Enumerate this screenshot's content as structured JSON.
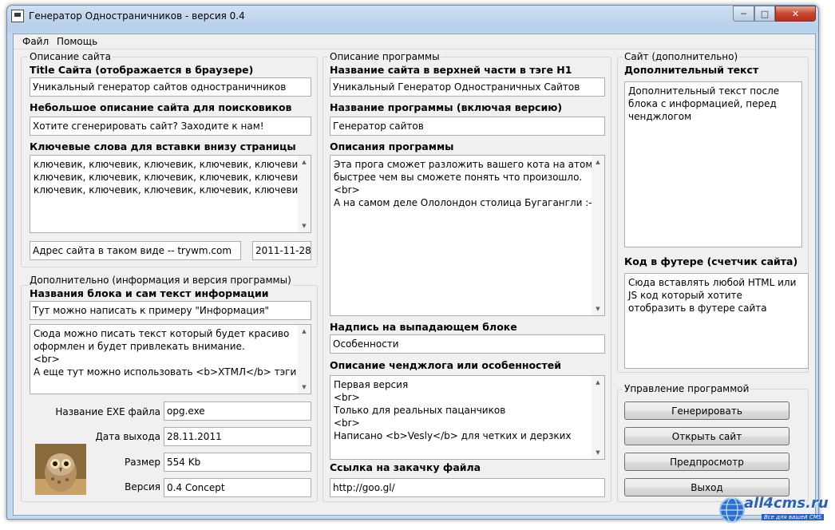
{
  "window": {
    "title": "Генератор Одностраничников - версия 0.4"
  },
  "menu": [
    "Файл",
    "Помощь"
  ],
  "site_group": {
    "legend": "Описание сайта",
    "title_label": "Title Сайта (отображается в браузере)",
    "title_value": "Уникальный генератор сайтов одностраничников",
    "desc_label": "Небольшое описание сайта для поисковиков",
    "desc_value": "Хотите сгенерировать сайт? Заходите к нам!",
    "keywords_label": "Ключевые слова для вставки внизу страницы",
    "keywords_lines": [
      "ключевик, ключевик, ключевик, ключевик, ключевик,",
      "ключевик, ключевик, ключевик, ключевик, ключевик,",
      "ключевик, ключевик, ключевик, ключевик, ключевик,"
    ],
    "address_value": "Адрес сайта в таком виде -- trywm.com",
    "date_value": "2011-11-28"
  },
  "extra_group": {
    "legend": "Дополнительно (информация и версия программы)",
    "block_label": "Названия блока и сам текст информации",
    "block_title_value": "Тут можно написать к примеру \"Информация\"",
    "block_text_lines": [
      "Сюда можно писать текст который будет красиво",
      "оформлен и будет привлекать внимание.",
      "<br>",
      "А еще тут можно использовать <b>ХТМЛ</b> тэги"
    ],
    "exe_label": "Название EXE файла",
    "exe_value": "opg.exe",
    "release_label": "Дата выхода",
    "release_value": "28.11.2011",
    "size_label": "Размер",
    "size_value": "554 Kb",
    "version_label": "Версия",
    "version_value": "0.4 Concept"
  },
  "program_group": {
    "legend": "Описание программы",
    "h1_label": "Название сайта в верхней части в тэге H1",
    "h1_value": "Уникальный Генератор Одностраничных Сайтов",
    "name_label": "Название программы (включая версию)",
    "name_value": "Генератор сайтов",
    "desc_label": "Описания программы",
    "desc_lines": [
      "Эта прога сможет разложить вашего кота на атомы",
      "быстрее чем вы сможете понять что произошло.",
      "<br>",
      "А на самом деле Ололондон столица Бугагангли :-)"
    ],
    "dropdown_label": "Надпись на выпадающем блоке",
    "dropdown_value": "Особенности",
    "changelog_label": "Описание ченджлога или особенностей",
    "changelog_lines": [
      "Первая версия",
      "<br>",
      "Только для реальных пацанчиков",
      "<br>",
      "Написано <b>Vesly</b> для четких и дерзких"
    ],
    "download_label": "Ссылка на закачку файла",
    "download_value": "http://goo.gl/"
  },
  "site_extra_group": {
    "legend": "Сайт (дополнительно)",
    "text_label": "Дополнительный текст",
    "text_value": "Дополнительный текст после блока с информацией, перед ченджлогом",
    "footer_label": "Код в футере (счетчик сайта)",
    "footer_value": "Сюда вставлять любой HTML или JS код который хотите отобразить в футере сайта"
  },
  "control_group": {
    "legend": "Управление программой",
    "generate": "Генерировать",
    "open_site": "Открыть сайт",
    "preview": "Предпросмотр",
    "exit": "Выход"
  },
  "watermark": {
    "brand": "all4cms.ru",
    "tagline": "Все для вашей CMS"
  },
  "colors": {
    "window_frame": "#b7cfe9",
    "close_button": "#c9452f",
    "client": "#f0f0f0"
  }
}
